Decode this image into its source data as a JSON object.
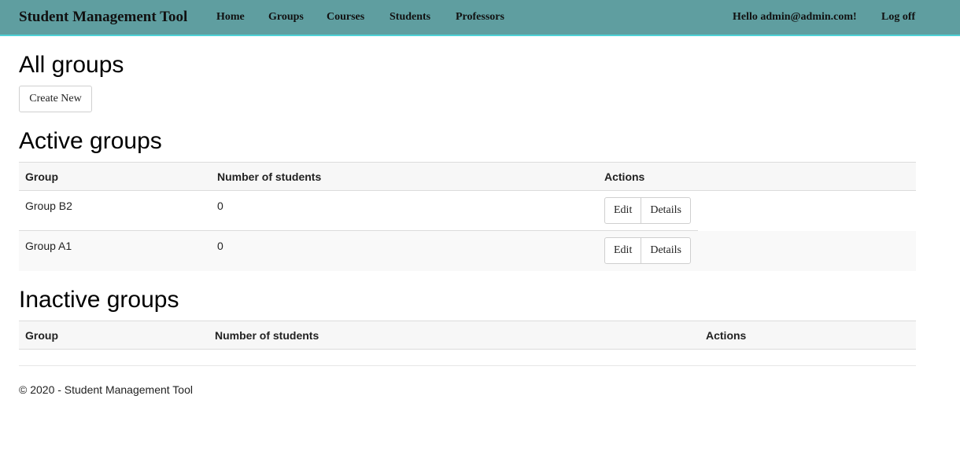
{
  "navbar": {
    "brand": "Student Management Tool",
    "links": [
      "Home",
      "Groups",
      "Courses",
      "Students",
      "Professors"
    ],
    "greeting": "Hello admin@admin.com!",
    "logoff": "Log off",
    "colors": {
      "background": "#5f9ea0",
      "accent_border": "#4fd1d6"
    }
  },
  "page": {
    "title": "All groups",
    "create_new": "Create New"
  },
  "active": {
    "heading": "Active groups",
    "columns": [
      "Group",
      "Number of students",
      "Actions"
    ],
    "rows": [
      {
        "group": "Group B2",
        "students": "0",
        "edit": "Edit",
        "details": "Details"
      },
      {
        "group": "Group A1",
        "students": "0",
        "edit": "Edit",
        "details": "Details"
      }
    ]
  },
  "inactive": {
    "heading": "Inactive groups",
    "columns": [
      "Group",
      "Number of students",
      "Actions"
    ]
  },
  "footer": {
    "text": "© 2020 - Student Management Tool"
  }
}
